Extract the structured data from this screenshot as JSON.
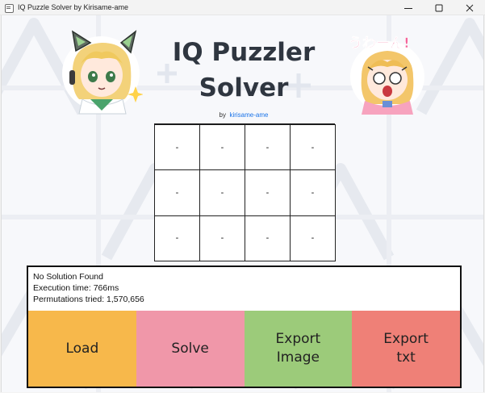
{
  "window": {
    "title": "IQ Puzzle Solver by Kirisame-ame",
    "controls": [
      "minimize",
      "maximize",
      "close"
    ]
  },
  "header": {
    "title_line1": "IQ Puzzler",
    "title_line2": "Solver",
    "byline_prefix": "by",
    "author_link": "kirisame-ame"
  },
  "mascots": {
    "right_caption": "うわーん!"
  },
  "grid": {
    "rows": 3,
    "cols": 4,
    "cells": [
      [
        "-",
        "-",
        "-",
        "-"
      ],
      [
        "-",
        "-",
        "-",
        "-"
      ],
      [
        "-",
        "-",
        "-",
        "-"
      ]
    ]
  },
  "status": {
    "message": "No Solution Found",
    "execution_time": "Execution time: 766ms",
    "permutations": "Permutations tried: 1,570,656"
  },
  "buttons": [
    {
      "label": "Load",
      "color": "#f7b84b"
    },
    {
      "label": "Solve",
      "color": "#f097a9"
    },
    {
      "label": "Export\nImage",
      "color": "#9ccb7a"
    },
    {
      "label": "Export\ntxt",
      "color": "#ef8077"
    }
  ],
  "colors": {
    "title": "#2f3640",
    "link": "#1a73e8"
  }
}
